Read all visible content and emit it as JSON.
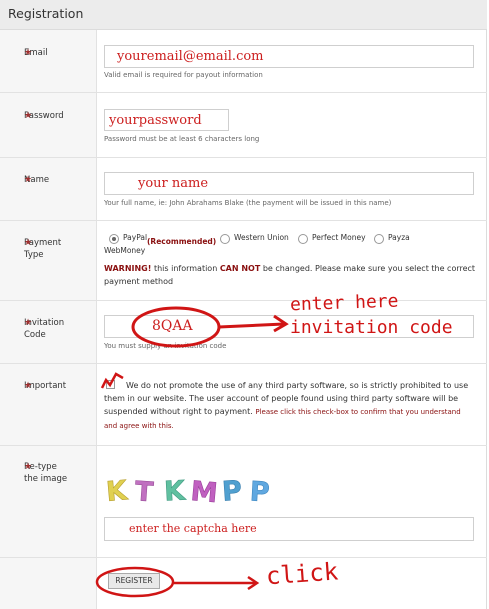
{
  "header": {
    "title": "Registration"
  },
  "email": {
    "label": "Email",
    "value": "youremail@email.com",
    "hint": "Valid email is required for payout information"
  },
  "password": {
    "label": "Password",
    "value": "yourpassword",
    "hint": "Password must be at least 6 characters long"
  },
  "name": {
    "label": "Name",
    "value": "your name",
    "hint": "Your full name, ie: John Abrahams Blake (the payment will be issued in this name)"
  },
  "payment": {
    "label": "Payment Type",
    "options": [
      "PayPal",
      "Western Union",
      "Perfect Money",
      "Payza",
      "WebMoney"
    ],
    "recommended": "(Recommended)",
    "selected": "PayPal",
    "warning_strong": "WARNING!",
    "warning_mid": " this information ",
    "warning_cannot": "CAN NOT",
    "warning_rest": " be changed. Please make sure you select the correct payment method"
  },
  "invitation": {
    "label": "Invitation Code",
    "value": "8QAA",
    "hint": "You must supply an invitation code"
  },
  "important": {
    "label": "Important",
    "notice": "We do not promote the use of any third party software, so is strictly prohibited to use them in our website. The user account of people found using third party software will be suspended without right to payment.",
    "confirm": "Please click this check-box to confirm that you understand and agree with this."
  },
  "captcha": {
    "label": "Re-type the image",
    "image_text": "KTKMPP",
    "value": "enter the captcha here"
  },
  "register": {
    "label": "REGISTER"
  },
  "annotations": {
    "enter_here": "enter here",
    "invitation_code": "invitation code",
    "click": "click"
  },
  "colors": {
    "annotation": "#d01515",
    "label_bg": "#f6f6f6",
    "header_bg": "#ececec"
  }
}
